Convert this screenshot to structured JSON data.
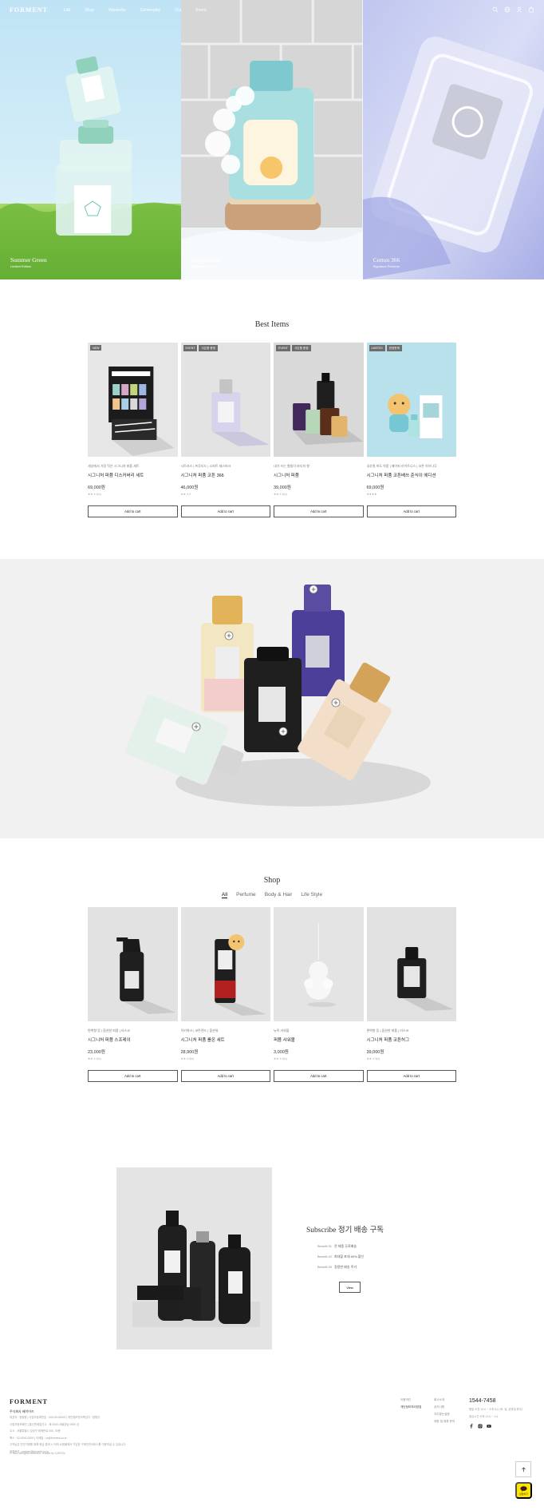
{
  "header": {
    "logo": "FORMENT",
    "nav": [
      "Lab",
      "Shop",
      "Wardrobe",
      "Community",
      "Our",
      "Event"
    ],
    "icons": [
      "search-icon",
      "globe-icon",
      "user-icon",
      "cart-icon"
    ]
  },
  "hero": {
    "panels": [
      {
        "title": "Summer Green",
        "subtitle": "Limited Edition"
      },
      {
        "title": "Cotton Bath",
        "subtitle": "Signature Perfume"
      },
      {
        "title": "Cotton 366",
        "subtitle": "Signature Perfume"
      }
    ]
  },
  "best_items": {
    "title": "Best Items",
    "cart_label": "Add to cart",
    "products": [
      {
        "badges": [
          "NEW"
        ],
        "desc": "세상에서 가장 작은 시그니처 퍼퓸 세트",
        "name": "시그니처 퍼퓸 디스커버리 세트",
        "price": "69,000원",
        "rating": "★★ 4.9(n)"
      },
      {
        "badges": [
          "EVENT",
          "사은품 증정"
        ],
        "desc": "시트러스 | 프루티드 | 소피트 재스퍼크",
        "name": "시그니처 퍼퓸 코튼 366",
        "price": "46,000원",
        "rating": "★★ 4.9"
      },
      {
        "badges": [
          "EVENT",
          "사은품 증정"
        ],
        "desc": "내가 쓰는 향들이 바디의 향",
        "name": "시그니처 퍼퓸",
        "price": "39,000원",
        "rating": "★★ 4.9(n)"
      },
      {
        "badges": [
          "LIMITED",
          "한정판매"
        ],
        "desc": "내추럴 파도 약품 | 페이퍼 라이트니스 | 코튼 허브나무",
        "name": "시그니처 퍼퓸 코튼배쓰 춘식이 에디션",
        "price": "69,000원",
        "rating": "★★★★"
      }
    ]
  },
  "shop": {
    "title": "Shop",
    "tabs": [
      "All",
      "Perfume",
      "Body & Hair",
      "Life Style"
    ],
    "active_tab": "All",
    "cart_label": "Add to cart",
    "products": [
      {
        "desc": "편백향 등 | 옵션한 퍼퓸 | 라스코",
        "name": "시그니처 퍼퓸 스프레이",
        "price": "23,000원",
        "rating": "★★ 4.9(n)"
      },
      {
        "desc": "럭키위크 | 코튼렌드 | 옵션워",
        "name": "시그니처 퍼퓸 롤온 세트",
        "price": "28,900원",
        "rating": "★★ 4.9(n)"
      },
      {
        "desc": "뉴욕 샤워볼",
        "name": "퍼퓸 샤워볼",
        "price": "3,000원",
        "rating": "★★ 4.9(n)"
      },
      {
        "desc": "편백향 등 | 옵션한 퍼퓸 | 라스코",
        "name": "시그니처 퍼퓸 코튼허그",
        "price": "39,000원",
        "rating": "★★ 4.9(n)"
      }
    ]
  },
  "subscribe": {
    "title": "Subscribe 정기 배송 구독",
    "benefits": [
      {
        "label": "Benefit 01",
        "text": "전 제품 무료배송"
      },
      {
        "label": "Benefit 02",
        "text": "최대할 포대 60% 할인"
      },
      {
        "label": "Benefit 03",
        "text": "정용한 배송 주기"
      }
    ],
    "button": "View"
  },
  "footer": {
    "logo": "FORMENT",
    "company": "주식회사 베이어즈",
    "info_lines": [
      "대표자 : 정종원 | 사업자등록번호 : 000-00-00000 | 개인정보관리책임자 : 정병규",
      "사업자정보확인 | 통신판매업신고 : 제 0000-서울강남-0000 호",
      "주소 : 서울특별시 강남구 테헤란로 000, 00층",
      "팩스 : 02-0000-0000 | 이메일 : cs@forment.co.kr",
      "고객님은 안전거래를 위해 현금 결제 시 저희 쇼핑몰에서 가입한 구매안전서비스를 이용하실 수 있습니다.",
      "제휴문의 : partner@forment.co.kr"
    ],
    "copyright": "© 2023 all rights reserved. Hosted by CAFE24",
    "col1": [
      "이용약관",
      "개인정보처리방침"
    ],
    "col2": [
      "회사소개",
      "공지사항",
      "자주묻는질문",
      "대량 및 제휴 문의"
    ],
    "phone": "1544-7458",
    "cs_lines": [
      "평일 오전 10시 ~ 오후 5시 (토, 일, 공휴일 휴무)",
      "점심시간 오후 12시 ~ 1시"
    ],
    "social": [
      "facebook-icon",
      "instagram-icon",
      "youtube-icon"
    ],
    "kakao_label": "상담하기"
  },
  "colors": {
    "accent": "#111111",
    "badge": "#6d6d6d",
    "kakao": "#fee500"
  }
}
